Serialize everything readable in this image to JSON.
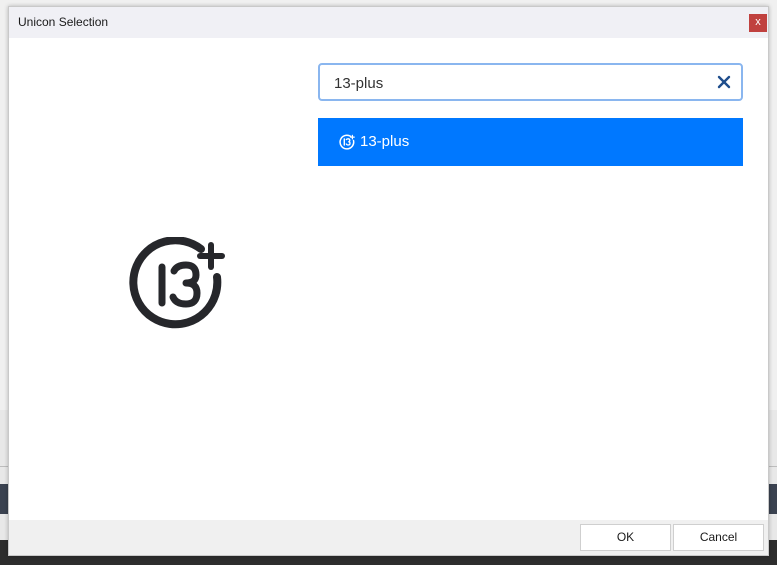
{
  "dialog": {
    "title": "Unicon Selection",
    "close_label": "x"
  },
  "search": {
    "value": "13-plus",
    "clear_icon": "close-icon"
  },
  "results": [
    {
      "label": "13-plus",
      "icon": "13-plus-icon",
      "selected": true
    }
  ],
  "preview": {
    "icon": "13-plus-icon"
  },
  "footer": {
    "ok_label": "OK",
    "cancel_label": "Cancel"
  },
  "colors": {
    "selection": "#0078ff",
    "close_button": "#c0413f",
    "search_border": "#8ab6ef",
    "icon_dark": "#26272b"
  }
}
